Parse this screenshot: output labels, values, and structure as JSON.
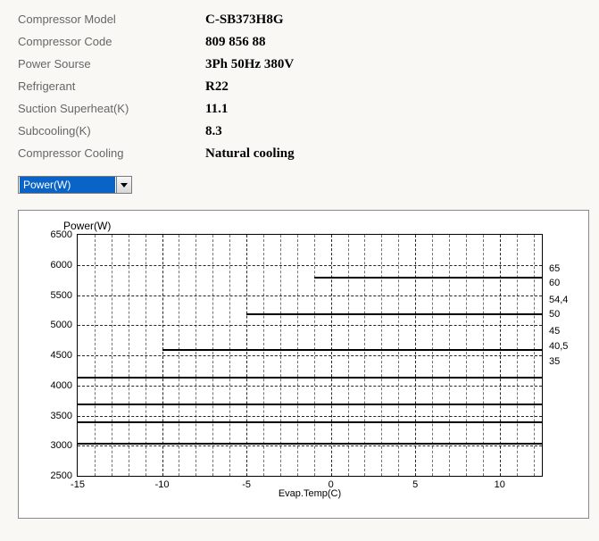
{
  "spec": {
    "model_label": "Compressor Model",
    "model_value": "C-SB373H8G",
    "code_label": "Compressor Code",
    "code_value": "809 856 88",
    "power_label": "Power Sourse",
    "power_value": "3Ph  50Hz  380V",
    "refr_label": "Refrigerant",
    "refr_value": "R22",
    "sh_label": "Suction Superheat(K)",
    "sh_value": "11.1",
    "sc_label": "Subcooling(K)",
    "sc_value": "8.3",
    "cool_label": "Compressor Cooling",
    "cool_value": "Natural cooling"
  },
  "select": {
    "current": "Power(W)"
  },
  "chart_data": {
    "type": "line",
    "title": "Power(W)",
    "xlabel": "Evap.Temp(C)",
    "ylabel": "",
    "xlim": [
      -15,
      12.5
    ],
    "ylim": [
      2500,
      6500
    ],
    "xticks": [
      -15,
      -10,
      -5,
      0,
      5,
      10
    ],
    "yticks": [
      2500,
      3000,
      3500,
      4000,
      4500,
      5000,
      5500,
      6000,
      6500
    ],
    "grid": true,
    "series_label_axis": "right",
    "series": [
      {
        "name": "35",
        "x_start": -15,
        "avg_value": 3050
      },
      {
        "name": "40,5",
        "x_start": -15,
        "avg_value": 3400
      },
      {
        "name": "45",
        "x_start": -15,
        "avg_value": 3700
      },
      {
        "name": "50",
        "x_start": -15,
        "avg_value": 4150
      },
      {
        "name": "54,4",
        "x_start": -10,
        "avg_value": 4600
      },
      {
        "name": "60",
        "x_start": -5,
        "avg_value": 5200
      },
      {
        "name": "65",
        "x_start": -1,
        "avg_value": 5800
      }
    ],
    "right_labels": [
      {
        "text": "65",
        "at_value": 5940
      },
      {
        "text": "60",
        "at_value": 5700
      },
      {
        "text": "54,4",
        "at_value": 5420
      },
      {
        "text": "50",
        "at_value": 5180
      },
      {
        "text": "45",
        "at_value": 4900
      },
      {
        "text": "40,5",
        "at_value": 4650
      },
      {
        "text": "35",
        "at_value": 4400
      }
    ]
  }
}
